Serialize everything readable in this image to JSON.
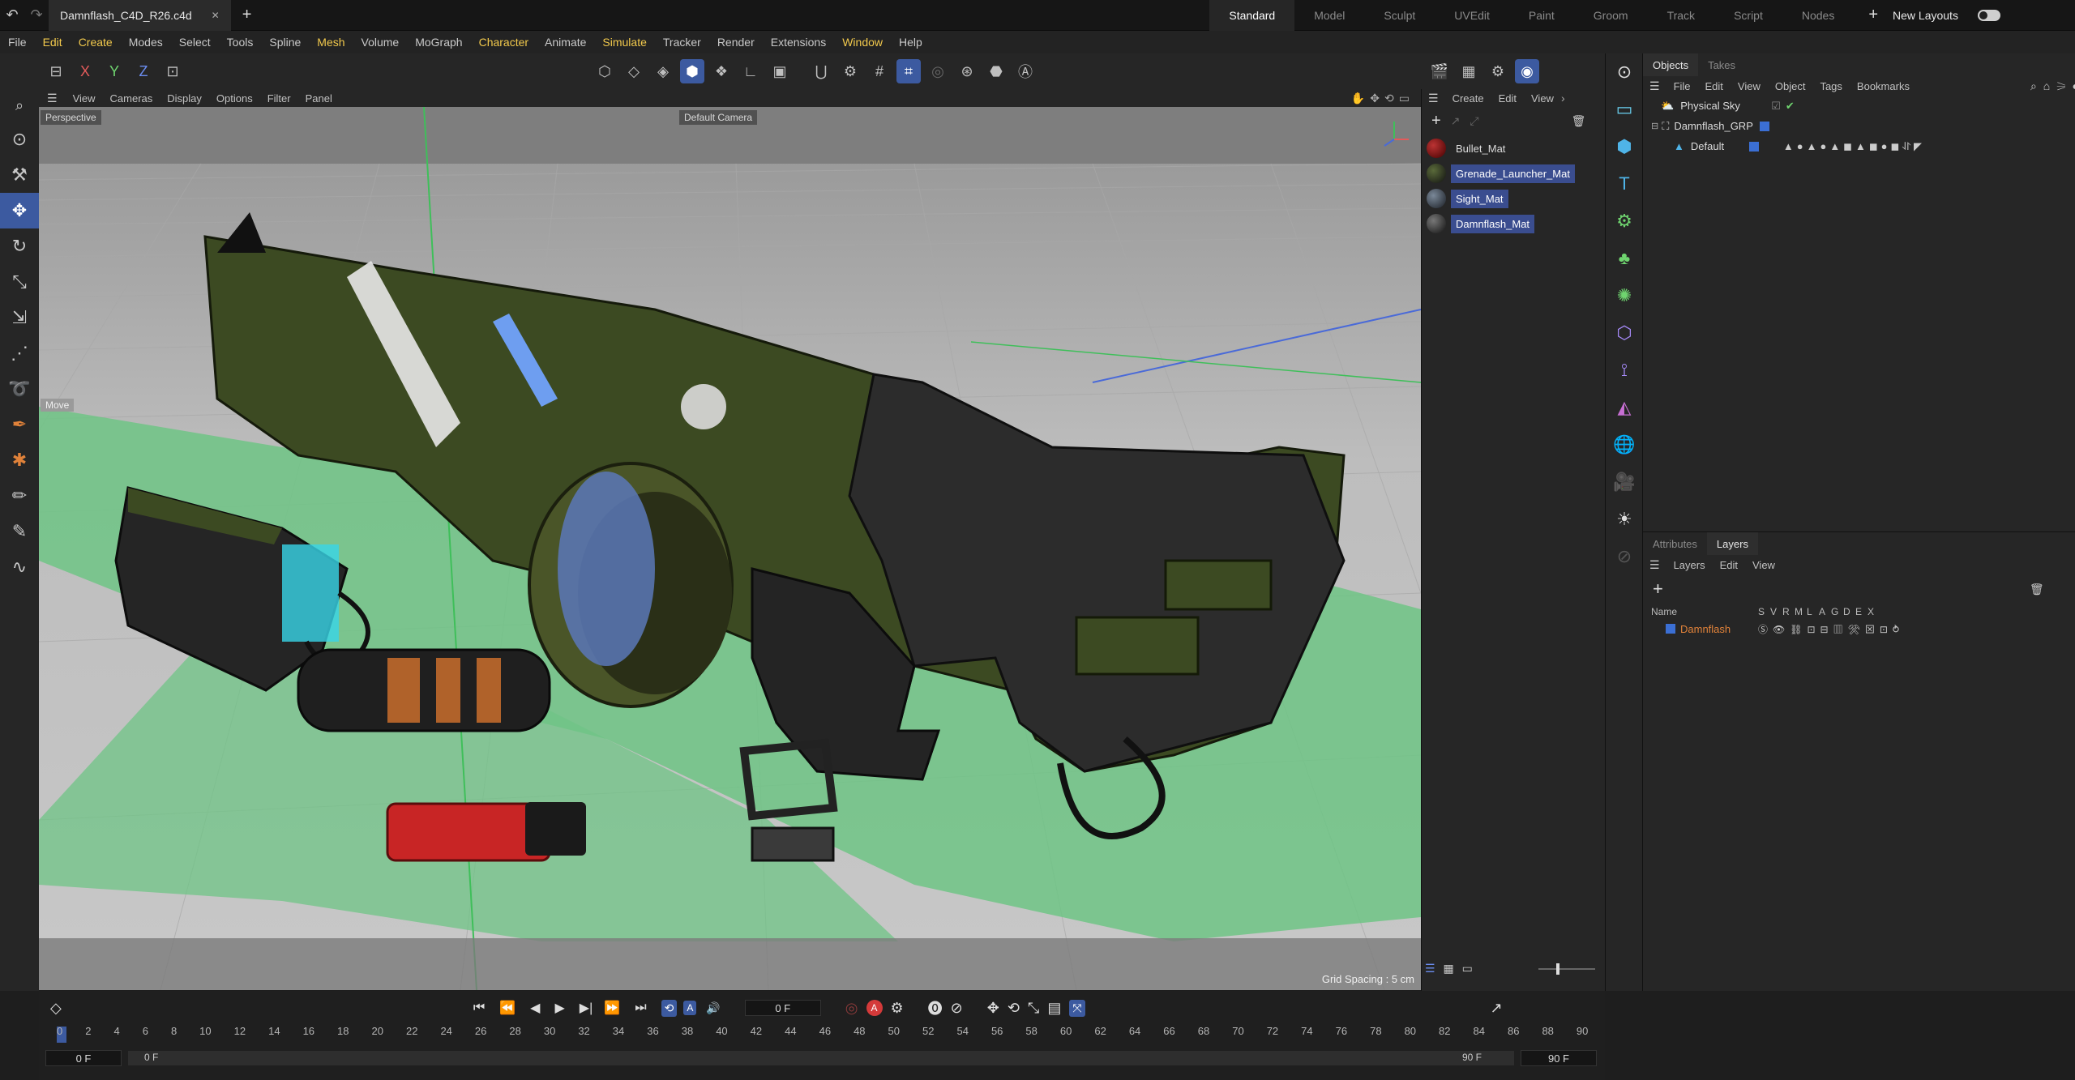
{
  "titlebar": {
    "file_tab": "Damnflash_C4D_R26.c4d",
    "close": "✕",
    "add": "+",
    "layouts": [
      "Standard",
      "Model",
      "Sculpt",
      "UVEdit",
      "Paint",
      "Groom",
      "Track",
      "Script",
      "Nodes"
    ],
    "active_layout": "Standard",
    "add_layout": "+",
    "new_layouts": "New Layouts"
  },
  "menubar": {
    "items": [
      "File",
      "Edit",
      "Create",
      "Modes",
      "Select",
      "Tools",
      "Spline",
      "Mesh",
      "Volume",
      "MoGraph",
      "Character",
      "Animate",
      "Simulate",
      "Tracker",
      "Render",
      "Extensions",
      "Window",
      "Help"
    ]
  },
  "toolbar": {
    "axes": [
      "X",
      "Y",
      "Z"
    ]
  },
  "viewport": {
    "menu": [
      "View",
      "Cameras",
      "Display",
      "Options",
      "Filter",
      "Panel"
    ],
    "perspective_label": "Perspective",
    "camera_label": "Default Camera",
    "move_label": "Move",
    "grid_spacing": "Grid Spacing : 5 cm"
  },
  "materials": {
    "menu": [
      "Create",
      "Edit",
      "View"
    ],
    "items": [
      {
        "name": "Bullet_Mat",
        "color": "#6a1a1a",
        "selected": false
      },
      {
        "name": "Grenade_Launcher_Mat",
        "color": "#2f3a1f",
        "selected": true
      },
      {
        "name": "Sight_Mat",
        "color": "#3a4450",
        "selected": true
      },
      {
        "name": "Damnflash_Mat",
        "color": "#333333",
        "selected": true
      }
    ]
  },
  "objects": {
    "tabs": [
      "Objects",
      "Takes"
    ],
    "menu": [
      "File",
      "Edit",
      "View",
      "Object",
      "Tags",
      "Bookmarks"
    ],
    "tree": [
      {
        "name": "Physical Sky",
        "indent": 0
      },
      {
        "name": "Damnflash_GRP",
        "indent": 0
      },
      {
        "name": "Default",
        "indent": 1
      }
    ]
  },
  "layers": {
    "tabs": [
      "Attributes",
      "Layers"
    ],
    "menu": [
      "Layers",
      "Edit",
      "View"
    ],
    "columns": [
      "Name",
      "S",
      "V",
      "R",
      "M",
      "L",
      "A",
      "G",
      "D",
      "E",
      "X"
    ],
    "rows": [
      {
        "name": "Damnflash",
        "color": "#3b6fd4"
      }
    ]
  },
  "timeline": {
    "current_frame": "0 F",
    "start_field": "0 F",
    "start_field2": "0 F",
    "end_field": "90 F",
    "end_field2": "90 F",
    "ticks": [
      "0",
      "2",
      "4",
      "6",
      "8",
      "10",
      "12",
      "14",
      "16",
      "18",
      "20",
      "22",
      "24",
      "26",
      "28",
      "30",
      "32",
      "34",
      "36",
      "38",
      "40",
      "42",
      "44",
      "46",
      "48",
      "50",
      "52",
      "54",
      "56",
      "58",
      "60",
      "62",
      "64",
      "66",
      "68",
      "70",
      "72",
      "74",
      "76",
      "78",
      "80",
      "82",
      "84",
      "86",
      "88",
      "90"
    ]
  },
  "colors": {
    "accent": "#3c5aa0",
    "highlight_menu": "#f2c94c",
    "layer_name": "#e0823a",
    "record": "#d43a3a",
    "floor_green": "#6fc485"
  }
}
